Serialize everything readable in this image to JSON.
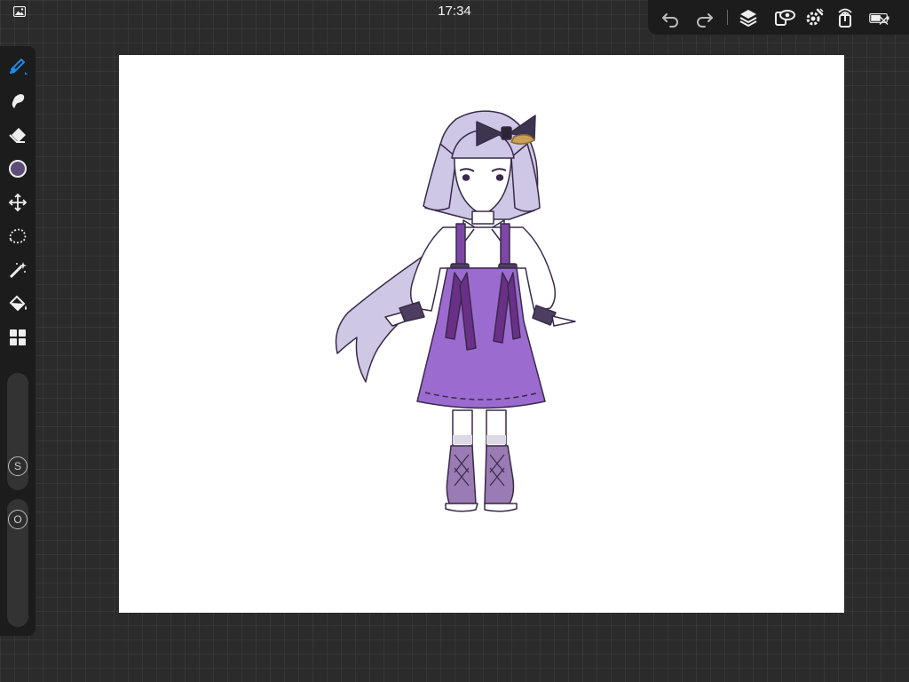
{
  "status_bar": {
    "time": "17:34",
    "gallery_icon": "photo-gallery-icon"
  },
  "top_toolbar": {
    "icons": [
      "undo-icon",
      "redo-icon",
      "layers-icon",
      "reference-eye-icon",
      "settings-gear-icon",
      "share-icon",
      "battery-icon"
    ]
  },
  "left_toolbar": {
    "tools": [
      "brush-icon",
      "smudge-icon",
      "eraser-icon",
      "color-swatch-icon",
      "transform-icon",
      "selection-icon",
      "magic-adjust-icon",
      "fill-bucket-icon",
      "quick-menu-grid-icon"
    ],
    "active_tool": "brush",
    "current_color": "#5e4b7a",
    "size_slider_label": "S",
    "opacity_slider_label": "O"
  },
  "colors": {
    "accent": "#1e88e5",
    "toolbar_bg": "#1c1c1c",
    "background": "#2b2b2b"
  }
}
